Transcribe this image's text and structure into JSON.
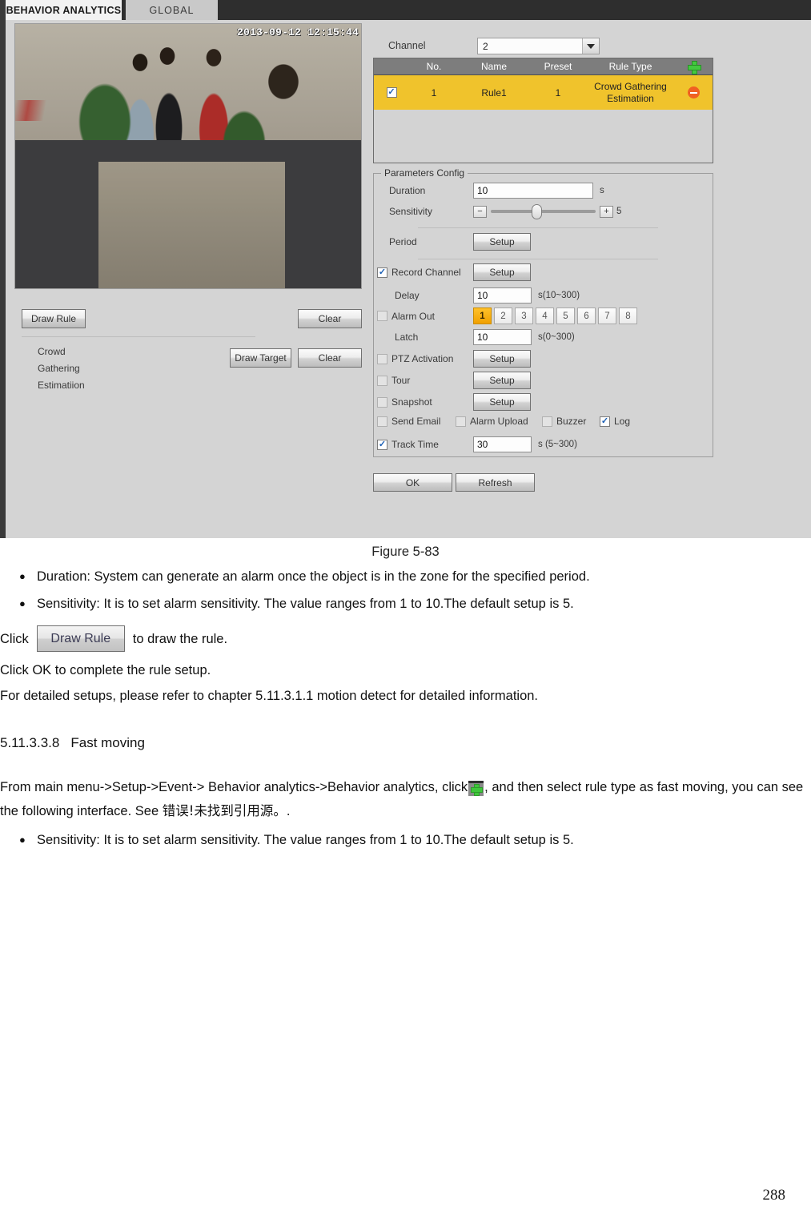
{
  "screenshot": {
    "tabs": [
      {
        "label": "BEHAVIOR ANALYTICS",
        "active": true
      },
      {
        "label": "GLOBAL",
        "active": false
      }
    ],
    "video": {
      "timestamp": "2013-09-12 12:15:44"
    },
    "left_controls": {
      "draw_rule_label": "Draw Rule",
      "clear_rule_label": "Clear",
      "rule_name_lines": [
        "Crowd",
        "Gathering",
        "Estimatiion"
      ],
      "draw_target_label": "Draw Target",
      "clear_target_label": "Clear"
    },
    "channel": {
      "label": "Channel",
      "value": "2"
    },
    "rule_table": {
      "headers": [
        "No.",
        "Name",
        "Preset",
        "Rule Type"
      ],
      "add_icon": "plus-icon",
      "rows": [
        {
          "checked": true,
          "no": "1",
          "name": "Rule1",
          "preset": "1",
          "rule_type": "Crowd Gathering Estimatiion",
          "remove_icon": "minus-icon"
        }
      ]
    },
    "parameters_config": {
      "legend": "Parameters Config",
      "duration": {
        "label": "Duration",
        "value": "10",
        "unit": "s"
      },
      "sensitivity": {
        "label": "Sensitivity",
        "value": "5",
        "min": "1",
        "max": "10",
        "minus": "−",
        "plus": "+"
      },
      "period": {
        "label": "Period",
        "button": "Setup"
      },
      "record_channel": {
        "label": "Record Channel",
        "checked": true,
        "button": "Setup"
      },
      "delay": {
        "label": "Delay",
        "value": "10",
        "unit": "s(10~300)"
      },
      "alarm_out": {
        "label": "Alarm Out",
        "checked": false,
        "buttons": [
          "1",
          "2",
          "3",
          "4",
          "5",
          "6",
          "7",
          "8"
        ],
        "selected": "1"
      },
      "latch": {
        "label": "Latch",
        "value": "10",
        "unit": "s(0~300)"
      },
      "ptz_activation": {
        "label": "PTZ Activation",
        "checked": false,
        "button": "Setup"
      },
      "tour": {
        "label": "Tour",
        "checked": false,
        "button": "Setup"
      },
      "snapshot": {
        "label": "Snapshot",
        "checked": false,
        "button": "Setup"
      },
      "notify": [
        {
          "label": "Send Email",
          "checked": false
        },
        {
          "label": "Alarm Upload",
          "checked": false
        },
        {
          "label": "Buzzer",
          "checked": false
        },
        {
          "label": "Log",
          "checked": true
        }
      ],
      "track_time": {
        "label": "Track Time",
        "checked": true,
        "value": "30",
        "unit": "s (5~300)"
      }
    },
    "footer_buttons": {
      "ok": "OK",
      "refresh": "Refresh"
    },
    "colors": {
      "selected_row": "#f0c32c",
      "table_header": "#7d7d7d",
      "alarm_out_selected": "#ffc12a",
      "add_icon": "#43c93f",
      "remove_icon": "#f06122"
    }
  },
  "document": {
    "figure_caption": "Figure 5-83",
    "bullet_duration": "Duration: System can generate an alarm once the object is in the zone for the specified period.",
    "bullet_sensitivity": "Sensitivity: It is to set alarm sensitivity. The value ranges from 1 to 10.The default setup is 5.",
    "click_prefix": "Click",
    "inline_button_label": "Draw Rule",
    "click_suffix": "to draw the rule.",
    "click_ok_line": "Click OK to complete the rule setup.",
    "detailed_setups_line": "For detailed setups, please refer to chapter 5.11.3.1.1 motion detect for detailed information.",
    "heading_number": "5.11.3.3.8",
    "heading_title": "Fast moving",
    "para_fast_moving_part1": "From main menu->Setup->Event-> Behavior analytics->Behavior analytics, click",
    "para_fast_moving_part2": ", and then select rule type as fast moving, you can see the following interface. See",
    "para_fast_moving_ref": "错误!未找到引用源。",
    "para_fast_moving_part3": ".",
    "bullet_sensitivity2": "Sensitivity: It is to set alarm sensitivity. The value ranges from 1 to 10.The default setup is 5.",
    "bullet_char": "●",
    "page_number": "288"
  }
}
